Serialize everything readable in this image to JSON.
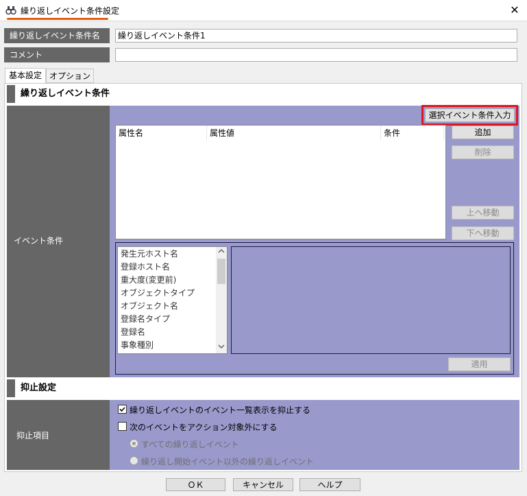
{
  "window": {
    "title": "繰り返しイベント条件設定",
    "app_icon": "binoculars-icon",
    "close_glyph": "✕"
  },
  "form": {
    "name_label": "繰り返しイベント条件名",
    "name_value": "繰り返しイベント条件1",
    "comment_label": "コメント",
    "comment_value": ""
  },
  "tabs": [
    {
      "label": "基本設定",
      "active": true
    },
    {
      "label": "オプション",
      "active": false
    }
  ],
  "event_section": {
    "title": "繰り返しイベント条件",
    "row_label": "イベント条件",
    "select_button": "選択イベント条件入力",
    "columns": [
      "属性名",
      "属性値",
      "条件"
    ],
    "buttons": {
      "add": "追加",
      "delete": "削除",
      "move_up": "上へ移動",
      "move_down": "下へ移動",
      "apply": "適用"
    },
    "attribute_list": [
      "発生元ホスト名",
      "登録ホスト名",
      "重大度(変更前)",
      "オブジェクトタイプ",
      "オブジェクト名",
      "登録名タイプ",
      "登録名",
      "事象種別"
    ]
  },
  "suppress_section": {
    "title": "抑止設定",
    "row_label": "抑止項目",
    "options": [
      {
        "label": "繰り返しイベントのイベント一覧表示を抑止する",
        "checked": true
      },
      {
        "label": "次のイベントをアクション対象外にする",
        "checked": false
      }
    ],
    "radios": [
      {
        "label": "すべての繰り返しイベント",
        "selected": true
      },
      {
        "label": "繰り返し開始イベント以外の繰り返しイベント",
        "selected": false
      }
    ]
  },
  "footer": {
    "ok": "ＯＫ",
    "cancel": "キャンセル",
    "help": "ヘルプ"
  },
  "colors": {
    "panel": "#9999cc",
    "label_bg": "#666666",
    "highlight": "#e0141e",
    "title_underline": "#e06010"
  }
}
